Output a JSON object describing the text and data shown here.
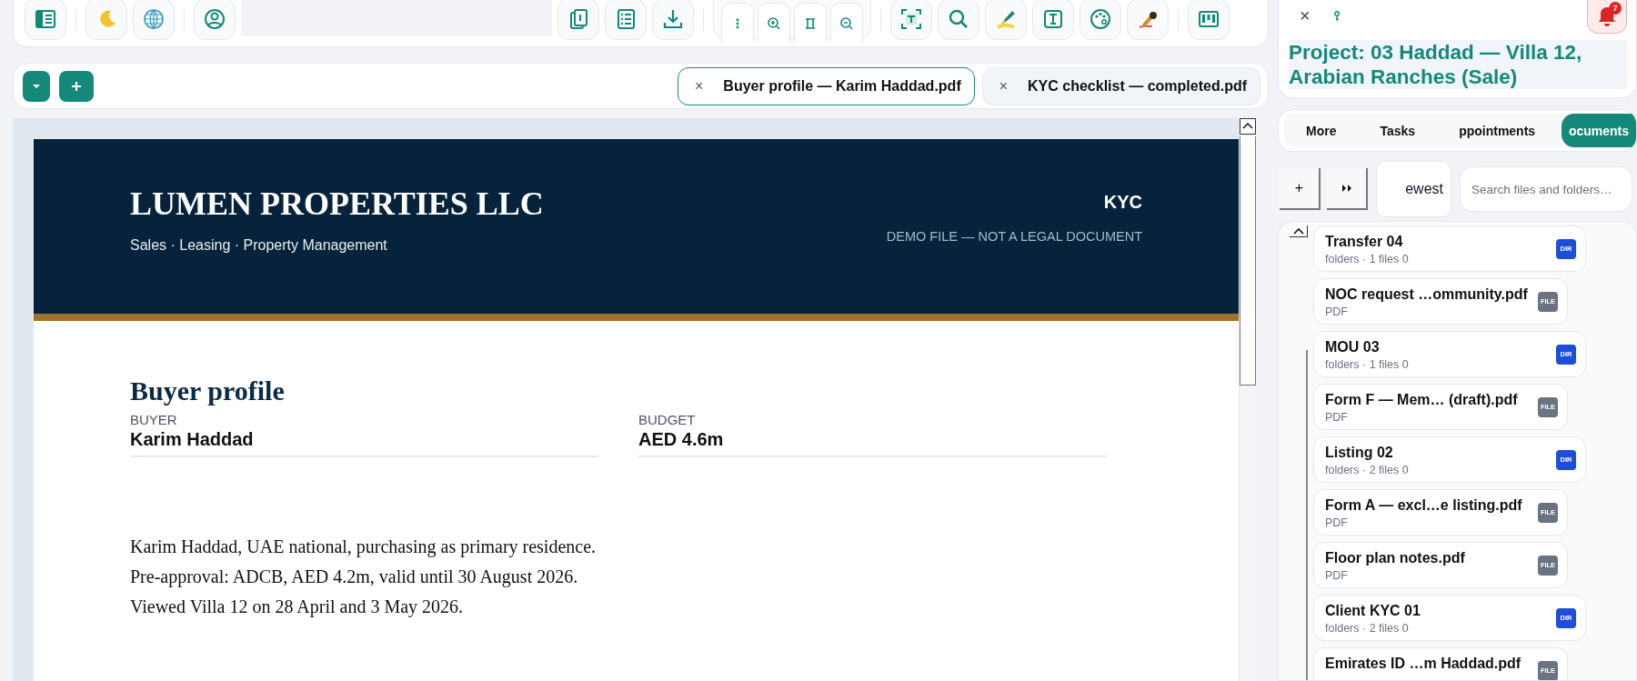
{
  "tab_bar": {
    "tabs": [
      {
        "close": "×",
        "label": "Buyer profile — Karim Haddad.pdf",
        "selected": true
      },
      {
        "close": "×",
        "label": "KYC checklist — completed.pdf",
        "selected": false
      }
    ]
  },
  "document": {
    "company": "LUMEN PROPERTIES LLC",
    "tagline": "Sales · Leasing · Property Management",
    "doc_type": "KYC",
    "disclaimer": "DEMO FILE — NOT A LEGAL DOCUMENT",
    "heading": "Buyer profile",
    "fields": [
      {
        "label": "BUYER",
        "value": "Karim Haddad"
      },
      {
        "label": "BUDGET",
        "value": "AED 4.6m"
      }
    ],
    "notes": [
      "Karim Haddad, UAE national, purchasing as primary residence.",
      "Pre-approval: ADCB, AED 4.2m, valid until 30 August 2026.",
      "Viewed Villa 12 on 28 April and 3 May 2026."
    ]
  },
  "side_panel": {
    "close": "×",
    "notification_count": "7",
    "add": "+",
    "project_title": "Project: 03 Haddad — Villa 12, Arabian Ranches (Sale)",
    "tabs": [
      {
        "label": "More",
        "selected": false
      },
      {
        "label": "Tasks",
        "selected": false
      },
      {
        "label": "ppointments",
        "selected": false
      },
      {
        "label": "ocuments",
        "selected": true
      }
    ],
    "sort": "ewest",
    "search": {
      "placeholder": "Search files and folders…"
    },
    "items": [
      {
        "kind": "folder",
        "name": "Transfer 04",
        "meta": "folders · 1 files 0",
        "badge": "DIR"
      },
      {
        "kind": "file",
        "name": "NOC request …ommunity.pdf",
        "meta": "PDF",
        "badge": "FILE"
      },
      {
        "kind": "folder",
        "name": "MOU 03",
        "meta": "folders · 1 files 0",
        "badge": "DIR"
      },
      {
        "kind": "file",
        "name": "Form F — Mem… (draft).pdf",
        "meta": "PDF",
        "badge": "FILE"
      },
      {
        "kind": "folder",
        "name": "Listing 02",
        "meta": "folders · 2 files 0",
        "badge": "DIR"
      },
      {
        "kind": "file",
        "name": "Form A — excl…e listing.pdf",
        "meta": "PDF",
        "badge": "FILE"
      },
      {
        "kind": "file",
        "name": "Floor plan notes.pdf",
        "meta": "PDF",
        "badge": "FILE"
      },
      {
        "kind": "folder",
        "name": "Client KYC 01",
        "meta": "folders · 2 files 0",
        "badge": "DIR"
      },
      {
        "kind": "file",
        "name": "Emirates ID …m Haddad.pdf",
        "badge": "FILE"
      }
    ]
  }
}
